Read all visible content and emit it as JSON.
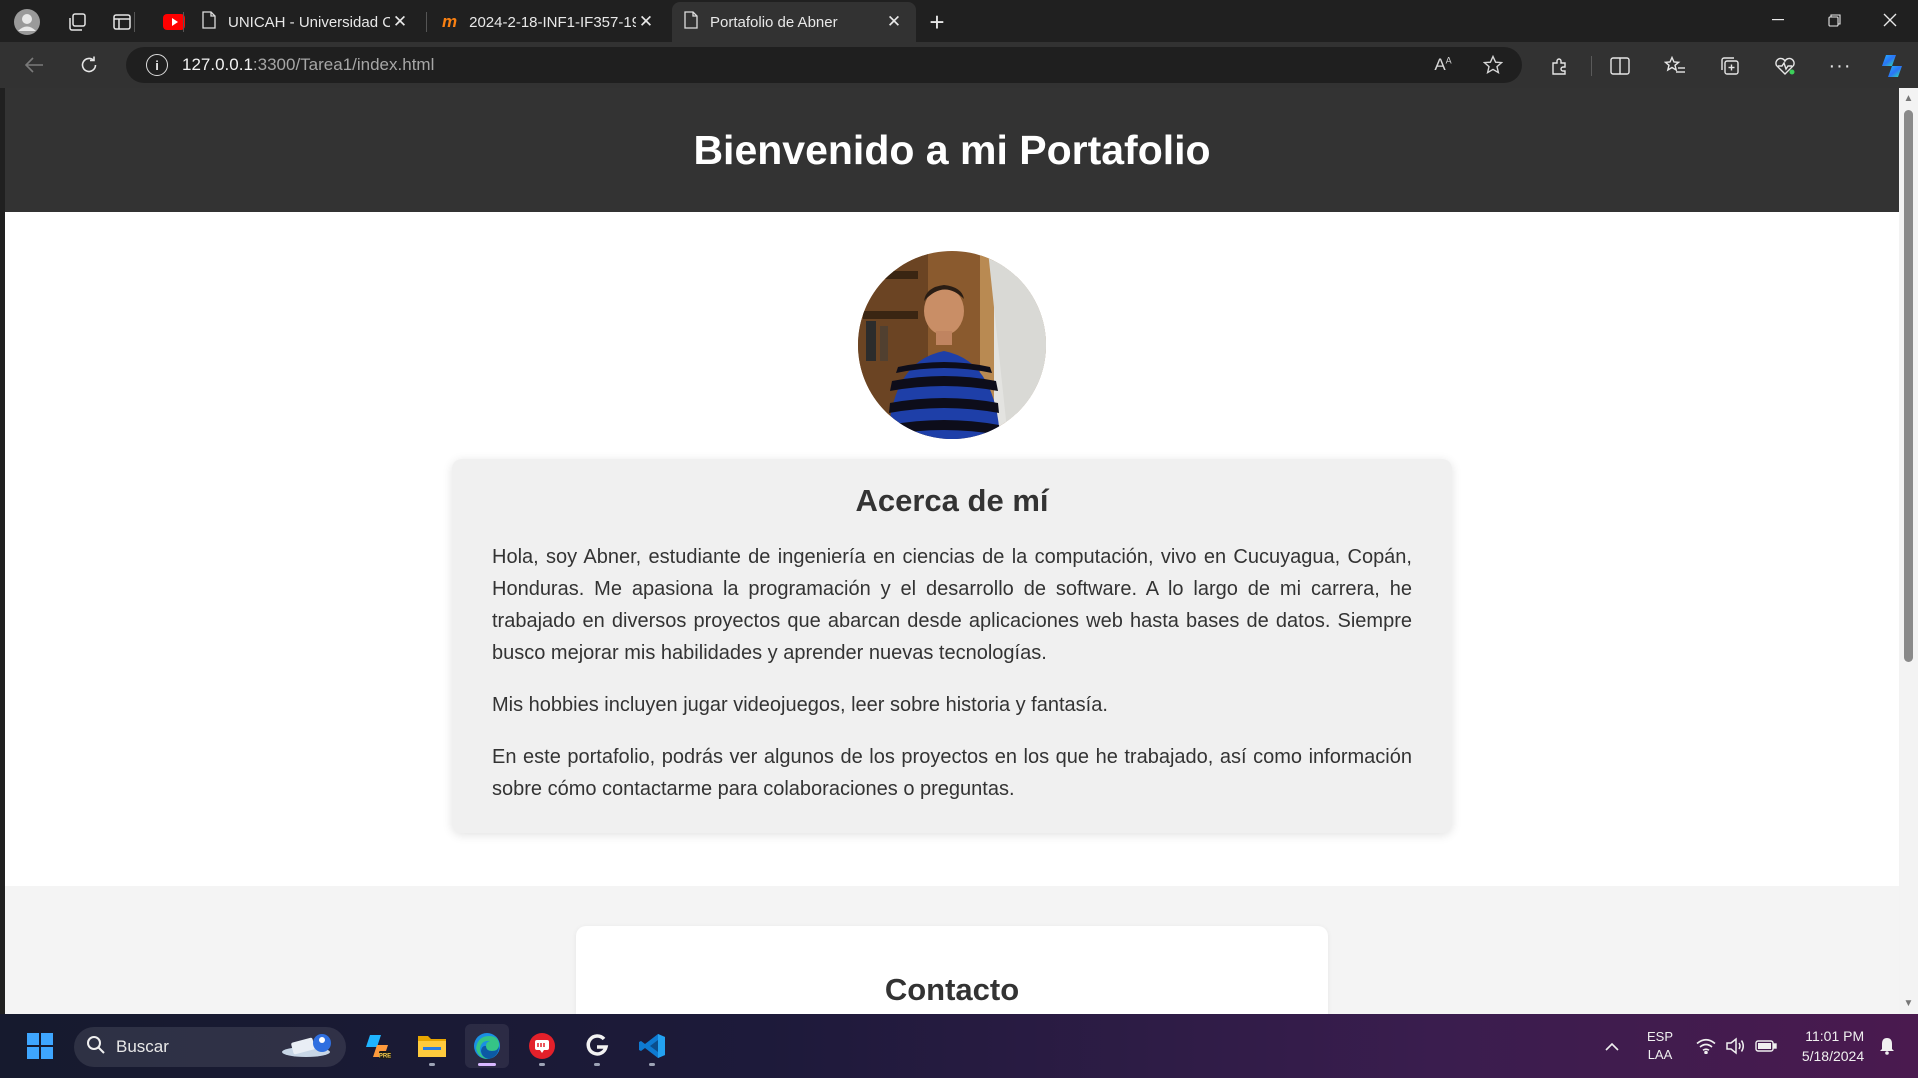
{
  "browser": {
    "tabs": [
      {
        "title": "UNICAH - Universidad Católica d",
        "active": false
      },
      {
        "title": "2024-2-18-INF1-IF357-1901: Perf",
        "active": false
      },
      {
        "title": "Portafolio de Abner",
        "active": true
      }
    ],
    "url_host": "127.0.0.1",
    "url_rest": ":3300/Tarea1/index.html"
  },
  "page": {
    "header_title": "Bienvenido a mi Portafolio",
    "about": {
      "heading": "Acerca de mí",
      "paragraphs": [
        "Hola, soy Abner, estudiante de ingeniería en ciencias de la computación, vivo en Cucuyagua, Copán, Honduras. Me apasiona la programación y el desarrollo de software. A lo largo de mi carrera, he trabajado en diversos proyectos que abarcan desde aplicaciones web hasta bases de datos. Siempre busco mejorar mis habilidades y aprender nuevas tecnologías.",
        "Mis hobbies incluyen jugar videojuegos, leer sobre historia y fantasía.",
        "En este portafolio, podrás ver algunos de los proyectos en los que he trabajado, así como información sobre cómo contactarme para colaboraciones o preguntas."
      ]
    },
    "contact": {
      "heading": "Contacto"
    }
  },
  "taskbar": {
    "search_placeholder": "Buscar",
    "language": "ESP",
    "keyboard": "LAA",
    "time": "11:01 PM",
    "date": "5/18/2024"
  },
  "colors": {
    "header_bg": "#333333",
    "card_bg": "#f0f0f0",
    "browser_chrome": "#202020"
  }
}
